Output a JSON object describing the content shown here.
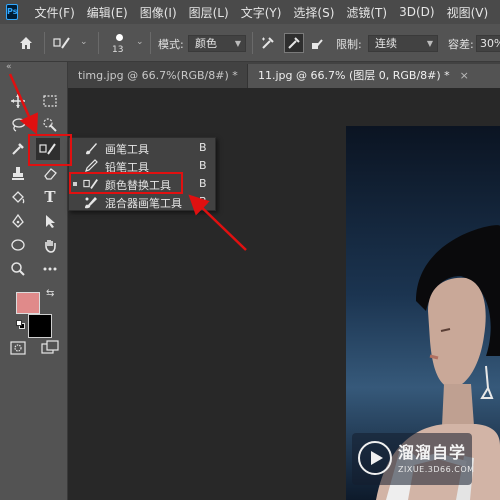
{
  "app": {
    "logo_text": "Ps"
  },
  "menu": [
    "文件(F)",
    "编辑(E)",
    "图像(I)",
    "图层(L)",
    "文字(Y)",
    "选择(S)",
    "滤镜(T)",
    "3D(D)",
    "视图(V)"
  ],
  "options_bar": {
    "brush_size": "13",
    "mode_label": "模式:",
    "mode_value": "颜色",
    "limit_label": "限制:",
    "limit_value": "连续",
    "tolerance_label": "容差:",
    "tolerance_value": "30%"
  },
  "tabs": [
    {
      "label": "timg.jpg @ 66.7%(RGB/8#) *",
      "close": "×",
      "active": false
    },
    {
      "label": "11.jpg @ 66.7% (图层 0, RGB/8#) *",
      "close": "×",
      "active": true
    }
  ],
  "toolbar": {
    "collapse": "«",
    "text_tool": "T"
  },
  "colors": {
    "foreground": "#e08a8a",
    "background": "#000000",
    "accent_red": "#e01010"
  },
  "flyout": [
    {
      "label": "画笔工具",
      "key": "B",
      "icon": "brush-icon",
      "selected": false
    },
    {
      "label": "铅笔工具",
      "key": "B",
      "icon": "pencil-icon",
      "selected": false
    },
    {
      "label": "颜色替换工具",
      "key": "B",
      "icon": "color-replacement-icon",
      "selected": true
    },
    {
      "label": "混合器画笔工具",
      "key": "B",
      "icon": "mixer-brush-icon",
      "selected": false
    }
  ],
  "watermark": {
    "title": "溜溜自学",
    "subtitle": "ZIXUE.3D66.COM"
  }
}
